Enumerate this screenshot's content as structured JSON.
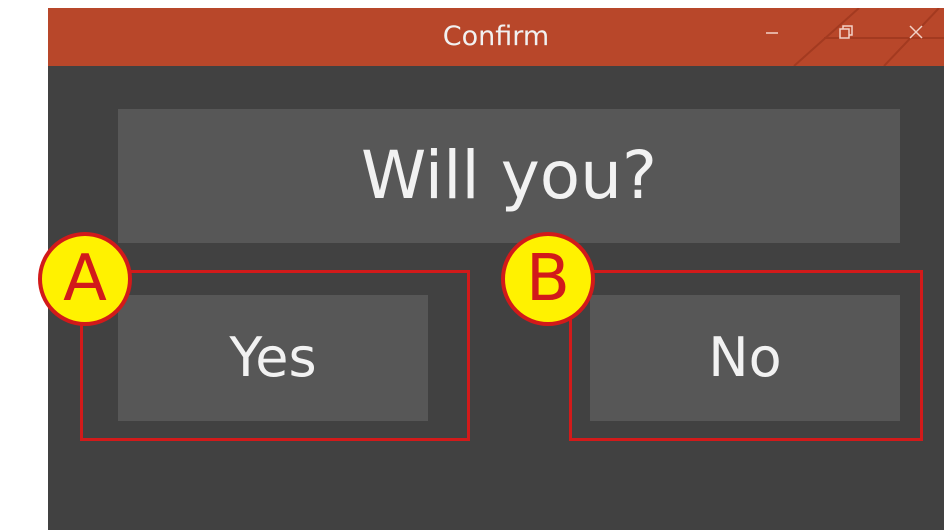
{
  "window": {
    "title": "Confirm",
    "titlebar_color": "#b8472a",
    "background_color": "#414141",
    "controls": {
      "minimize_icon": "minimize-icon",
      "maximize_icon": "restore-icon",
      "close_icon": "close-icon"
    }
  },
  "dialog": {
    "message": "Will you?",
    "yes_label": "Yes",
    "no_label": "No",
    "panel_color": "#575757"
  },
  "annotations": {
    "marker_a": "A",
    "marker_b": "B",
    "highlight_color": "#d21a1a",
    "marker_fill": "#fff200"
  }
}
